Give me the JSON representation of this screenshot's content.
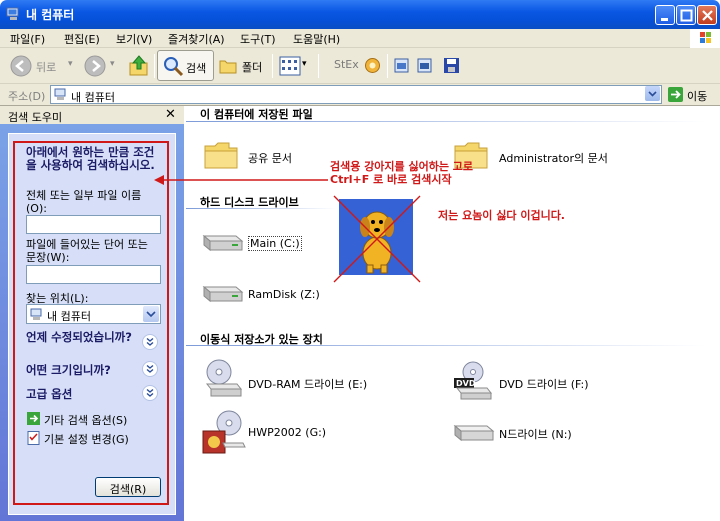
{
  "window": {
    "title": "내 컴퓨터"
  },
  "menu": [
    "파일(F)",
    "편집(E)",
    "보기(V)",
    "즐겨찾기(A)",
    "도구(T)",
    "도움말(H)"
  ],
  "toolbar": {
    "back_label": "뒤로",
    "search_label": "검색",
    "folders_label": "폴더",
    "stex_label": "StEx"
  },
  "address": {
    "label": "주소(D)",
    "value": "내 컴퓨터",
    "go_label": "이동"
  },
  "search_pane": {
    "title": "검색 도우미",
    "heading": "아래에서 원하는 만큼 조건을 사용하여 검색하십시오.",
    "filename_label": "전체 또는 일부 파일 이름(O):",
    "filename_value": "",
    "contents_label": "파일에 들어있는 단어 또는 문장(W):",
    "contents_value": "",
    "location_label": "찾는 위치(L):",
    "location_value": "내 컴퓨터",
    "modified_label": "언제 수정되었습니까?",
    "size_label": "어떤 크기입니까?",
    "advanced_label": "고급 옵션",
    "other_options_label": "기타 검색 옵션(S)",
    "default_settings_label": "기본 설정 변경(G)",
    "search_button": "검색(R)"
  },
  "main": {
    "stored_files_header": "이 컴퓨터에 저장된 파일",
    "stored_files": [
      {
        "label": "공유 문서",
        "icon": "folder-icon"
      },
      {
        "label": "Administrator의 문서",
        "icon": "folder-icon"
      }
    ],
    "hdd_header": "하드 디스크 드라이브",
    "drives": [
      {
        "label": "Main (C:)",
        "icon": "hard-drive-icon"
      },
      {
        "label": "RamDisk (Z:)",
        "icon": "hard-drive-icon"
      }
    ],
    "removable_header": "이동식 저장소가 있는 장치",
    "removable": [
      {
        "label": "DVD-RAM 드라이브 (E:)",
        "icon": "dvd-ram-drive-icon"
      },
      {
        "label": "DVD 드라이브 (F:)",
        "icon": "dvd-drive-icon"
      },
      {
        "label": "HWP2002 (G:)",
        "icon": "cd-drive-icon"
      },
      {
        "label": "N드라이브 (N:)",
        "icon": "network-drive-icon"
      }
    ]
  },
  "annotations": {
    "arrow_note": "검색용 강아지를 싫어하는 고로\nCtrl+F 로 바로 검색시작",
    "dog_note": "저는 요놈이 싫다 이겁니다."
  }
}
